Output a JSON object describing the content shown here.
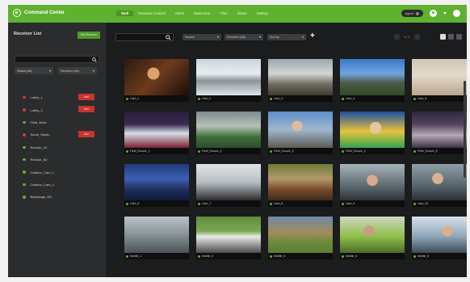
{
  "app": {
    "title": "Command Center",
    "nav": [
      {
        "label": "Wall",
        "active": true
      },
      {
        "label": "Receiver Control",
        "active": false
      },
      {
        "label": "Alerts",
        "active": false
      },
      {
        "label": "Multi-view",
        "active": false
      },
      {
        "label": "Tiles",
        "active": false
      },
      {
        "label": "Share",
        "active": false
      },
      {
        "label": "Setting",
        "active": false
      }
    ],
    "status_pill": "Agent",
    "accent_color": "#5fb130"
  },
  "sidebar": {
    "title": "Receiver List",
    "add_label": "Add Receiver",
    "search_placeholder": "",
    "filter_status": "Status (All)",
    "filter_sort": "Receiver (All)",
    "receivers": [
      {
        "name": "Lobby_1",
        "status_color": "#d13a34",
        "alert": "Alert"
      },
      {
        "name": "Lobby_2",
        "status_color": "#d13a34",
        "alert": "Alert"
      },
      {
        "name": "Field_West",
        "status_color": "#5fb130",
        "alert": ""
      },
      {
        "name": "South_Studio",
        "status_color": "#d13a34",
        "alert": "Alert"
      },
      {
        "name": "Remote_A1",
        "status_color": "#5fb130",
        "alert": ""
      },
      {
        "name": "Remote_B2",
        "status_color": "#5fb130",
        "alert": ""
      },
      {
        "name": "Outdoor_Cam_1",
        "status_color": "#5fb130",
        "alert": ""
      },
      {
        "name": "Outdoor_Cam_2",
        "status_color": "#5fb130",
        "alert": ""
      },
      {
        "name": "Backstage_HD",
        "status_color": "#5fb130",
        "alert": ""
      }
    ]
  },
  "toolbar": {
    "search_placeholder": "",
    "select_1": "Source",
    "select_2": "Receiver (All)",
    "select_3": "Sort by",
    "pager_text": "1 / 1"
  },
  "tiles": [
    {
      "label": "Cam_1",
      "status_color": "#5fb130"
    },
    {
      "label": "Cam_2",
      "status_color": "#5fb130"
    },
    {
      "label": "Cam_3",
      "status_color": "#5fb130"
    },
    {
      "label": "Cam_4",
      "status_color": "#5fb130"
    },
    {
      "label": "Cam_5",
      "status_color": "#5fb130"
    },
    {
      "label": "Field_Source_1",
      "status_color": "#5fb130"
    },
    {
      "label": "Field_Source_2",
      "status_color": "#5fb130"
    },
    {
      "label": "Field_Source_3",
      "status_color": "#5fb130"
    },
    {
      "label": "Field_Source_4",
      "status_color": "#5fb130"
    },
    {
      "label": "Field_Source_5",
      "status_color": "#5fb130"
    },
    {
      "label": "Cam_6",
      "status_color": "#5fb130"
    },
    {
      "label": "Cam_7",
      "status_color": "#5fb130"
    },
    {
      "label": "Cam_8",
      "status_color": "#5fb130"
    },
    {
      "label": "Cam_9",
      "status_color": "#5fb130"
    },
    {
      "label": "Cam_10",
      "status_color": "#5fb130"
    },
    {
      "label": "Mobile_1",
      "status_color": "#5fb130"
    },
    {
      "label": "Mobile_2",
      "status_color": "#5fb130"
    },
    {
      "label": "Mobile_3",
      "status_color": "#5fb130"
    },
    {
      "label": "Mobile_4",
      "status_color": "#5fb130"
    },
    {
      "label": "Mobile_5",
      "status_color": "#5fb130"
    }
  ]
}
